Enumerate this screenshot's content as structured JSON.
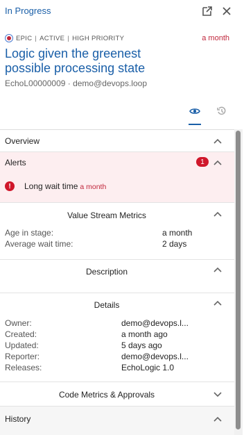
{
  "header": {
    "status": "In Progress"
  },
  "tags": {
    "epic": "EPIC",
    "active": "ACTIVE",
    "priority": "HIGH PRIORITY",
    "separator": "|"
  },
  "age": "a month",
  "title": "Logic given the greenest possible processing state",
  "subline": "EchoL00000009 · demo@devops.loop",
  "sections": {
    "overview": "Overview",
    "alerts": "Alerts",
    "alert_count": "1",
    "alert_text": "Long wait time",
    "alert_age": "a month",
    "vsm": "Value Stream Metrics",
    "description": "Description",
    "details": "Details",
    "code_metrics": "Code Metrics & Approvals",
    "history": "History"
  },
  "vsm": [
    {
      "label": "Age in stage:",
      "value": "a month"
    },
    {
      "label": "Average wait time:",
      "value": "2 days"
    }
  ],
  "details": [
    {
      "label": "Owner:",
      "value": "demo@devops.l..."
    },
    {
      "label": "Created:",
      "value": "a month ago"
    },
    {
      "label": "Updated:",
      "value": "5 days ago"
    },
    {
      "label": "Reporter:",
      "value": "demo@devops.l..."
    },
    {
      "label": "Releases:",
      "value": "EchoLogic 1.0"
    }
  ],
  "colors": {
    "accent": "#1a5fa8",
    "alert": "#d0172b",
    "alert_bg": "#fdeef0"
  },
  "icons": [
    "popout-icon",
    "close-icon",
    "eye-icon",
    "history-icon",
    "chevron-up-icon",
    "chevron-down-icon",
    "error-icon"
  ]
}
